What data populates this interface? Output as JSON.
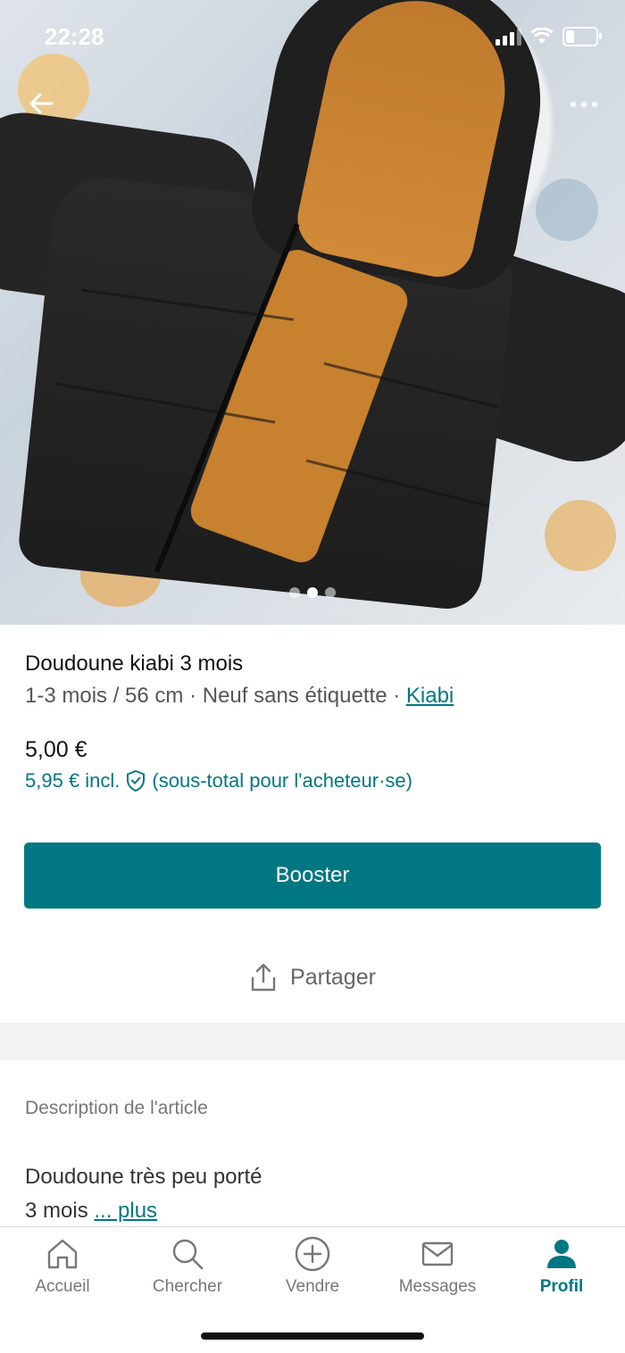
{
  "status_bar": {
    "time": "22:28"
  },
  "photo": {
    "image_count": 3,
    "active_index": 1
  },
  "item": {
    "title": "Doudoune kiabi 3 mois",
    "size": "1-3 mois / 56 cm",
    "condition": "Neuf sans étiquette",
    "brand": "Kiabi",
    "separator": "·",
    "price": "5,00 €",
    "price_incl": "5,95 € incl.",
    "price_incl_note": "(sous-total pour l'acheteur·se)"
  },
  "actions": {
    "booster_label": "Booster",
    "share_label": "Partager"
  },
  "description": {
    "label": "Description de l'article",
    "line1": "Doudoune très peu porté",
    "line2": "3 mois",
    "more_link": "... plus"
  },
  "tabbar": {
    "items": [
      {
        "label": "Accueil",
        "icon": "home-icon"
      },
      {
        "label": "Chercher",
        "icon": "search-icon"
      },
      {
        "label": "Vendre",
        "icon": "plus-circle-icon"
      },
      {
        "label": "Messages",
        "icon": "mail-icon"
      },
      {
        "label": "Profil",
        "icon": "person-icon",
        "active": true
      }
    ]
  },
  "colors": {
    "accent": "#007782",
    "text": "#111111",
    "muted": "#777777"
  }
}
